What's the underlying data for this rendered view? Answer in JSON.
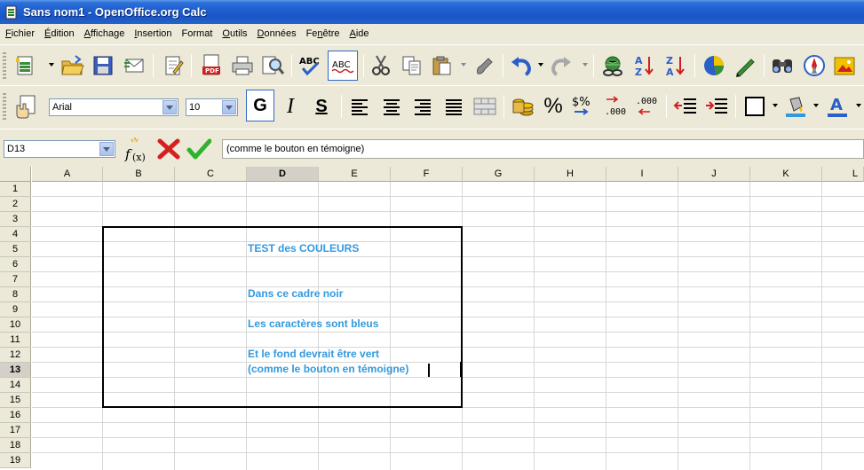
{
  "window": {
    "title": "Sans nom1 - OpenOffice.org Calc"
  },
  "menu": [
    {
      "u": "F",
      "rest": "ichier"
    },
    {
      "u": "É",
      "rest": "dition"
    },
    {
      "u": "A",
      "rest": "ffichage"
    },
    {
      "u": "I",
      "rest": "nsertion"
    },
    {
      "u": "F",
      "rest": "ormat",
      "plain": true
    },
    {
      "u": "O",
      "rest": "utils"
    },
    {
      "u": "D",
      "rest": "onnées"
    },
    {
      "u": "n",
      "pre": "Fe",
      "rest": "être"
    },
    {
      "u": "A",
      "rest": "ide"
    }
  ],
  "format": {
    "font_name": "Arial",
    "font_size": "10",
    "bold_label": "G",
    "italic_label": "I",
    "shadow_label": "S"
  },
  "formula": {
    "cell_ref": "D13",
    "content": "(comme le bouton en témoigne)"
  },
  "columns": [
    "A",
    "B",
    "C",
    "D",
    "E",
    "F",
    "G",
    "H",
    "I",
    "J",
    "K",
    "L"
  ],
  "rows": [
    "1",
    "2",
    "3",
    "4",
    "5",
    "6",
    "7",
    "8",
    "9",
    "10",
    "11",
    "12",
    "13",
    "14",
    "15",
    "16",
    "17",
    "18",
    "19"
  ],
  "cells": {
    "D5": "TEST des COULEURS",
    "D8": "Dans ce cadre noir",
    "D10": "Les caractères sont bleus",
    "D12": "Et le fond devrait être vert",
    "D13": "(comme le bouton en témoigne)"
  },
  "colors": {
    "cell_text": "#3399dd",
    "frame": "#000000",
    "accept": "#2db32d",
    "cancel": "#d42020"
  }
}
